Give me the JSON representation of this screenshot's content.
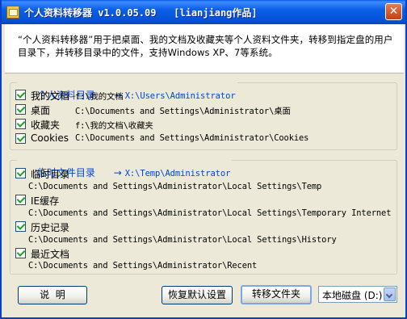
{
  "window": {
    "title": "个人资料转移器 v1.0.05.09   [lianjiang作品]",
    "close_glyph": "✕"
  },
  "intro": "“个人资料转移器”用于把桌面、我的文档及收藏夹等个人资料文件夹，转移到指定盘的用户目录下，并转移目录中的文件，支持Windows XP、7等系统。",
  "personal_group": {
    "title": "个人资料目录",
    "arrow": "→",
    "target": "X:\\Users\\Administrator",
    "items": [
      {
        "label": "我的文档",
        "path": "f:\\我的文档",
        "checked": true
      },
      {
        "label": "桌面",
        "path": "C:\\Documents and Settings\\Administrator\\桌面",
        "checked": true
      },
      {
        "label": "收藏夹",
        "path": "f:\\我的文档\\收藏夹",
        "checked": true
      },
      {
        "label": "Cookies",
        "path": "C:\\Documents and Settings\\Administrator\\Cookies",
        "checked": true
      }
    ]
  },
  "temp_group": {
    "title": "临时文件目录",
    "arrow": "→",
    "target": "X:\\Temp\\Administrator",
    "items": [
      {
        "label": "临时目录",
        "path": "C:\\Documents and Settings\\Administrator\\Local Settings\\Temp",
        "checked": true
      },
      {
        "label": "IE缓存",
        "path": "C:\\Documents and Settings\\Administrator\\Local Settings\\Temporary Internet",
        "checked": true
      },
      {
        "label": "历史记录",
        "path": "C:\\Documents and Settings\\Administrator\\Local Settings\\History",
        "checked": true
      },
      {
        "label": "最近文档",
        "path": "C:\\Documents and Settings\\Administrator\\Recent",
        "checked": true
      }
    ]
  },
  "buttons": {
    "help": "说  明",
    "restore": "恢复默认设置",
    "transfer": "转移文件夹"
  },
  "drive_select": {
    "value": "本地磁盘 (D:)"
  },
  "icons": {
    "checkbox": "checkmark-icon",
    "dropdown": "chevron-down-icon",
    "app": "folder-icon"
  }
}
